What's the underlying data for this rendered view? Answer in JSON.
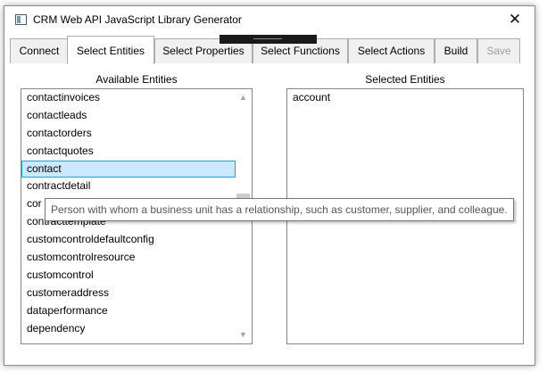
{
  "window": {
    "title": "CRM Web API JavaScript Library Generator",
    "close_glyph": "✕"
  },
  "tabs": [
    {
      "label": "Connect",
      "state": "normal"
    },
    {
      "label": "Select Entities",
      "state": "selected"
    },
    {
      "label": "Select Properties",
      "state": "normal"
    },
    {
      "label": "Select Functions",
      "state": "normal"
    },
    {
      "label": "Select Actions",
      "state": "normal"
    },
    {
      "label": "Build",
      "state": "normal"
    },
    {
      "label": "Save",
      "state": "disabled"
    }
  ],
  "available": {
    "label": "Available Entities",
    "items": [
      "contactinvoices",
      "contactleads",
      "contactorders",
      "contactquotes",
      "contact",
      "contractdetail",
      "contracttemplate_placeholder",
      "contracttemplate",
      "customcontroldefaultconfig",
      "customcontrolresource",
      "customcontrol",
      "customeraddress",
      "dataperformance",
      "dependency"
    ],
    "selected_index": 4,
    "scroll_up_glyph": "▲",
    "scroll_down_glyph": "▼",
    "scroll_fraction": 0.42
  },
  "selected": {
    "label": "Selected Entities",
    "items": [
      "account"
    ]
  },
  "tooltip": "Person with whom a business unit has a relationship, such as customer, supplier, and colleague.",
  "colors": {
    "selection_fill": "#cce8ff",
    "selection_border": "#26a0da",
    "disabled_text": "#a0a0a0"
  }
}
